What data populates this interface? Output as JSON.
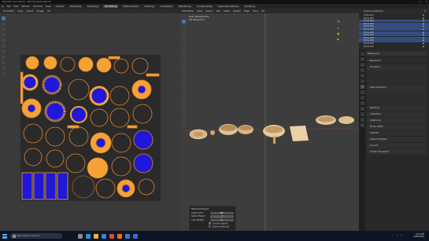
{
  "window": {
    "title": "Blender* [C:\\Users\\...\\kitchenware.blend]",
    "controls": [
      "–",
      "□",
      "✕"
    ]
  },
  "menubar": {
    "items": [
      "File",
      "Edit",
      "Render",
      "Window",
      "Help"
    ],
    "workspaces": [
      "Layout",
      "Modeling",
      "Sculpting",
      "UV Editing",
      "Texture Paint",
      "Shading",
      "Animation",
      "Rendering",
      "Compositing",
      "Geometry Nodes",
      "Scripting"
    ],
    "active_workspace": "UV Editing"
  },
  "uv_editor": {
    "header_items": [
      "UV Editor",
      "View",
      "Select",
      "Image",
      "UV"
    ],
    "tools": [
      "select-icon",
      "cursor-icon",
      "move-icon",
      "rotate-icon",
      "scale-icon",
      "transform-icon",
      "annotate-icon",
      "rip-icon",
      "grab-icon",
      "relax-icon",
      "pinch-icon"
    ],
    "colors": {
      "island": "#f4a236",
      "fill": "#1f18d6",
      "edge": "#e8842a"
    }
  },
  "viewport": {
    "header_items": [
      "Edit Mode",
      "View",
      "Select",
      "Add",
      "Mesh",
      "Vertex",
      "Edge",
      "Face",
      "UV"
    ],
    "info_line1": "User Perspective",
    "info_line2": "(0) Plane.011",
    "redo_panel": {
      "title": "Smart UV Project",
      "fields": [
        {
          "label": "Angle Limit",
          "value": "66°"
        },
        {
          "label": "Island Margin",
          "value": "0"
        },
        {
          "label": "Area Weight",
          "value": "0"
        }
      ],
      "checks": [
        "Correct Aspect",
        "Scale to Bounds"
      ]
    }
  },
  "outliner": {
    "title": "Scene Collection",
    "rows": [
      {
        "label": "Collection",
        "selected": false
      },
      {
        "label": "Plane.001",
        "selected": false
      },
      {
        "label": "Plane.002",
        "selected": true
      },
      {
        "label": "Plane.003",
        "selected": true
      },
      {
        "label": "Plane.004",
        "selected": true
      },
      {
        "label": "Plane.005",
        "selected": true
      },
      {
        "label": "Plane.006",
        "selected": true
      },
      {
        "label": "Plane.007",
        "selected": true
      },
      {
        "label": "Plane.008",
        "selected": true
      },
      {
        "label": "Plane.009",
        "selected": true
      },
      {
        "label": "Plane.010",
        "selected": false
      },
      {
        "label": "Plane.011",
        "selected": false
      }
    ]
  },
  "properties": {
    "header": "Plane.011",
    "object_name": "Plane.011",
    "sections": [
      "Transform",
      "Delta Transform",
      "Relations",
      "Collections",
      "Instancing",
      "Motion Paths",
      "Visibility",
      "Viewport Display",
      "Line Art",
      "Custom Properties"
    ]
  },
  "taskbar": {
    "search_placeholder": "Type here to search",
    "time": "4:41 PM",
    "date": "3/20/2022",
    "icons": [
      {
        "name": "task-view-icon",
        "color": "#8a8a8a"
      },
      {
        "name": "edge-icon",
        "color": "#2b8fe0"
      },
      {
        "name": "explorer-icon",
        "color": "#e9b73a"
      },
      {
        "name": "store-icon",
        "color": "#3a7fd0"
      },
      {
        "name": "chrome-icon",
        "color": "#d94b3d"
      },
      {
        "name": "blender-icon",
        "color": "#ea7600"
      },
      {
        "name": "photoshop-icon",
        "color": "#2f7ed8"
      },
      {
        "name": "mail-icon",
        "color": "#3b6bd1"
      }
    ]
  }
}
